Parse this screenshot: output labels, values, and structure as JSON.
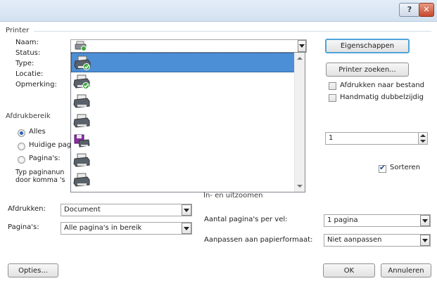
{
  "titlebar": {
    "help_label": "?",
    "close_label": "✕"
  },
  "printer_group": {
    "title": "Printer",
    "name_label": "Naam:",
    "status_label": "Status:",
    "type_label": "Type:",
    "location_label": "Locatie:",
    "comment_label": "Opmerking:",
    "properties_button": "Eigenschappen",
    "find_printer_button": "Printer zoeken...",
    "print_to_file_label": "Afdrukken naar bestand",
    "manual_duplex_label": "Handmatig dubbelzijdig",
    "print_to_file_checked": false,
    "manual_duplex_checked": false
  },
  "print_range": {
    "title": "Afdrukbereik",
    "all_label": "Alles",
    "current_page_label": "Huidige pag",
    "pages_label": "Pagina's:",
    "hint_line1": "Typ paginanun",
    "hint_line2": "door komma 's"
  },
  "copies": {
    "value": "1",
    "collate_label": "Sorteren",
    "collate_checked": true
  },
  "zoom": {
    "title": "In- en uitzoomen",
    "pages_per_sheet_label": "Aantal pagina's per vel:",
    "pages_per_sheet_value": "1 pagina",
    "scale_to_paper_label": "Aanpassen aan papierformaat:",
    "scale_to_paper_value": "Niet aanpassen"
  },
  "print_what": {
    "label": "Afdrukken:",
    "value": "Document"
  },
  "pages": {
    "label": "Pagina's:",
    "value": "Alle pagina's in bereik"
  },
  "footer": {
    "options_button": "Opties...",
    "ok_button": "OK",
    "cancel_button": "Annuleren"
  },
  "printer_list": {
    "items": [
      {
        "icon": "printer-icon",
        "selected": true
      },
      {
        "icon": "printer-icon",
        "selected": false
      },
      {
        "icon": "printer-icon",
        "selected": false
      },
      {
        "icon": "printer-icon",
        "selected": false
      },
      {
        "icon": "printer-icon",
        "selected": false
      },
      {
        "icon": "printer-icon",
        "selected": false
      },
      {
        "icon": "printer-icon",
        "selected": false
      }
    ]
  },
  "colors": {
    "selection": "#4d8fd6",
    "focus_border": "#4fa3d8",
    "titlebar": "#d3e1f0"
  }
}
